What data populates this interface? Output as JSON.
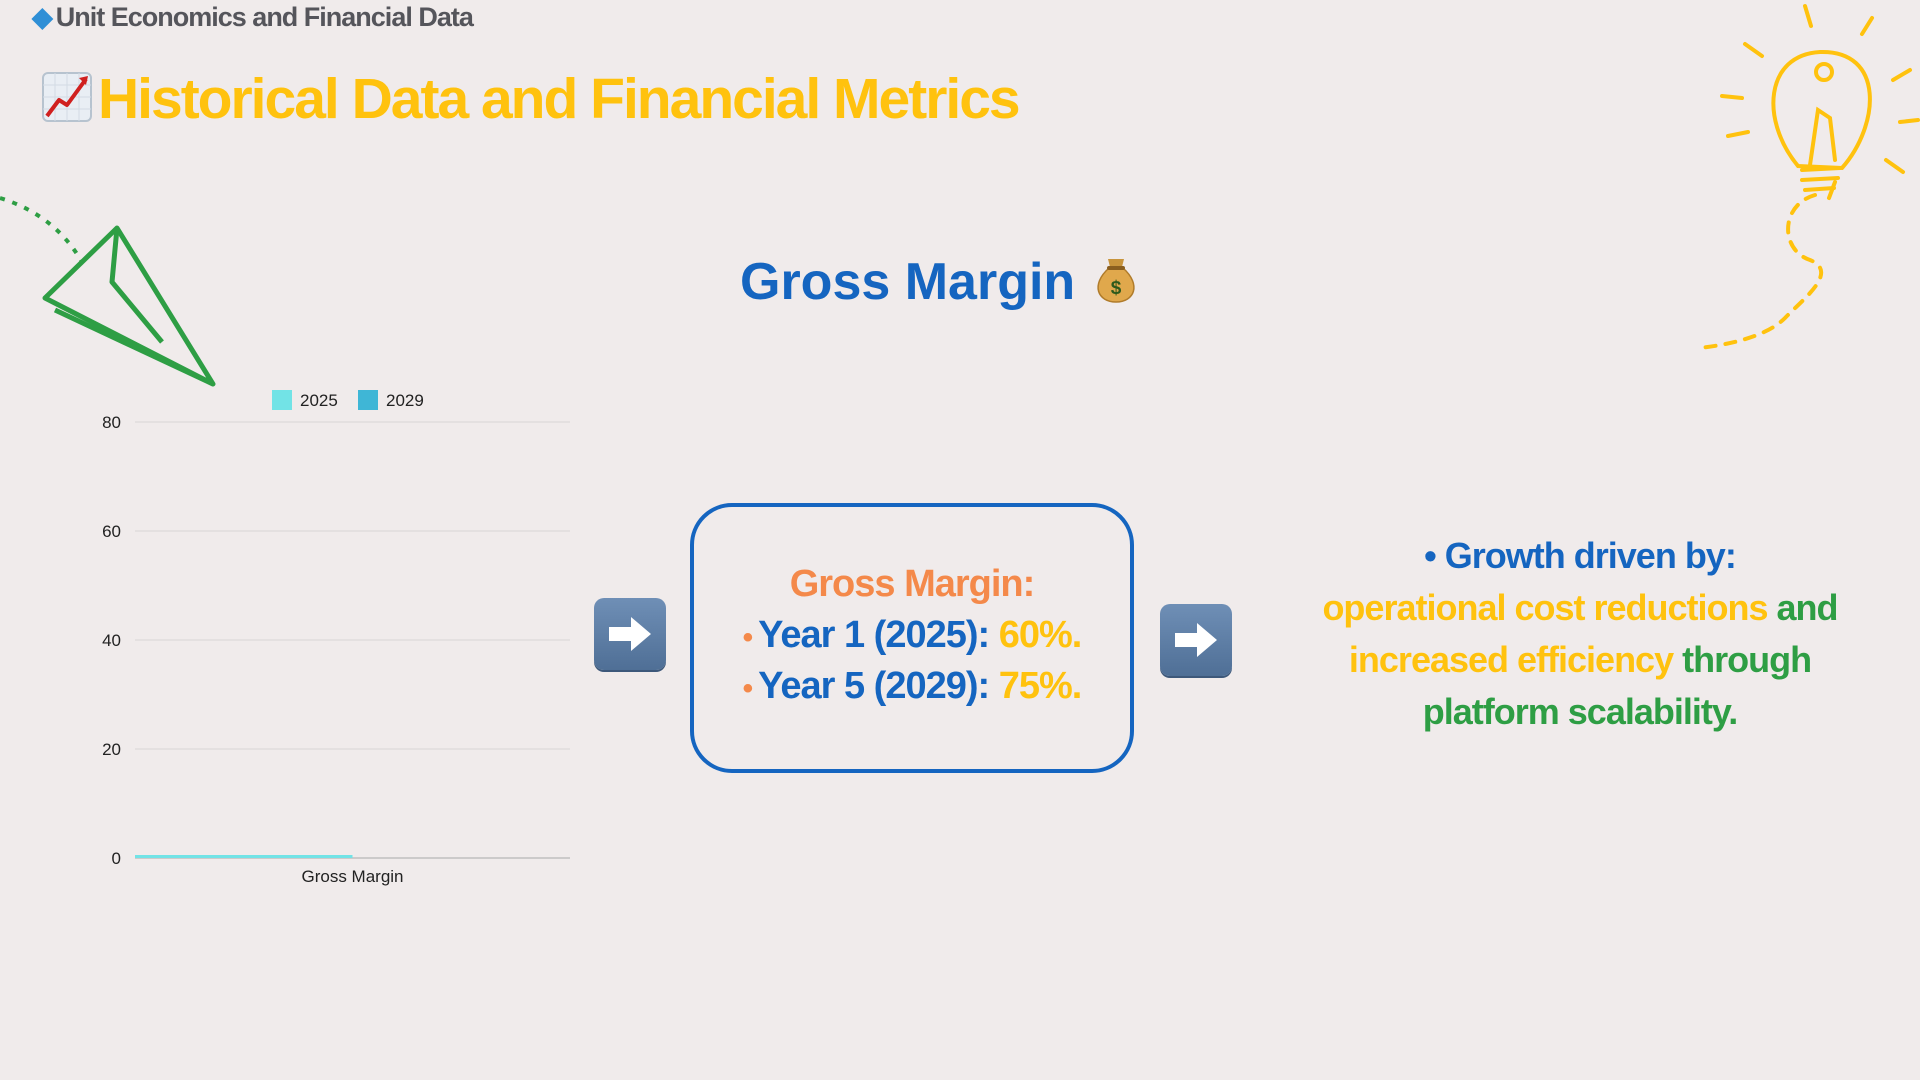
{
  "header": {
    "kicker_icon": "gem-icon",
    "kicker": "Unit Economics and Financial Data",
    "title_icon": "chart-increasing-icon",
    "title": "Historical Data and Financial Metrics"
  },
  "section": {
    "heading": "Gross Margin",
    "heading_icon": "money-bag-icon"
  },
  "chart_data": {
    "type": "bar",
    "categories": [
      "Gross Margin"
    ],
    "series": [
      {
        "name": "2025",
        "values": [
          0.5
        ],
        "color": "#72e3e6"
      },
      {
        "name": "2029",
        "values": [
          0
        ],
        "color": "#3fb6d6"
      }
    ],
    "yticks": [
      0,
      20,
      40,
      60,
      80
    ],
    "ylim": [
      0,
      80
    ],
    "legend": "top-center",
    "grid": true
  },
  "info_box": {
    "heading": "Gross Margin:",
    "bullet": "•",
    "lines": [
      {
        "label": "Year 1 (2025):",
        "value": "60%."
      },
      {
        "label": "Year 5 (2029):",
        "value": "75%."
      }
    ]
  },
  "growth": {
    "bullet": "•",
    "lead": "Growth driven by:",
    "part1": "operational cost reductions",
    "and": "and",
    "part2": "increased efficiency",
    "rest": "through platform scalability."
  },
  "colors": {
    "accent_yellow": "#ffc20e",
    "accent_blue": "#1565c0",
    "accent_orange": "#f4894a",
    "accent_green": "#2e9e44",
    "background": "#f0ebeb"
  },
  "decorations": [
    "paper-plane-icon",
    "lightbulb-icon",
    "arrow-right-icon"
  ]
}
